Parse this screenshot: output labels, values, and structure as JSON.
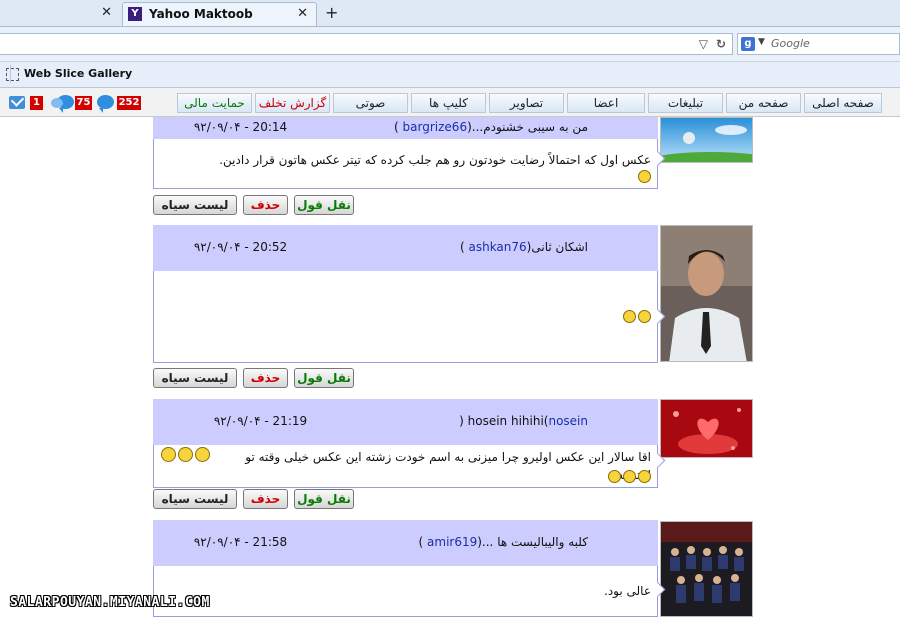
{
  "browser": {
    "tabs": [
      {
        "title": "",
        "close": "✕"
      },
      {
        "title": "Yahoo Maktoob",
        "favicon": "Y",
        "close": "✕"
      }
    ],
    "new_tab": "+",
    "search_placeholder": "Google",
    "search_icon_letter": "g",
    "favorites_item": "Web Slice Gallery"
  },
  "sitenav": {
    "badges": {
      "mail": "1",
      "chat": "75",
      "comments": "252"
    },
    "buttons": [
      "صفحه اصلی",
      "صفحه من",
      "تبلیغات",
      "اعضا",
      "تصاویر",
      "کلیپ ها",
      "صوتی",
      "گزارش تخلف",
      "حمایت مالی"
    ]
  },
  "actions": {
    "blacklist": "لیست سیاه",
    "delete": "حذف",
    "quote": "نقل قول"
  },
  "posts": [
    {
      "time": "۹۲/۰۹/۰۴ - 20:14",
      "title_prefix": "من به سیبی خشنودم...(",
      "username": "bargrize66",
      "title_suffix": " )",
      "text": "عکس اول که احتمالاً رضایت خودتون رو هم جلب کرده که تیتر عکس هاتون قرار دادین.",
      "emoji_count": 1,
      "avatar": "nature-icon"
    },
    {
      "time": "۹۲/۰۹/۰۴ - 20:52",
      "title_prefix": "اشکان ثانی(",
      "username": "ashkan76",
      "title_suffix": " )",
      "text": "",
      "emoji_count": 2,
      "avatar": "person-photo"
    },
    {
      "time": "۹۲/۰۹/۰۴ - 21:19",
      "title_prefix": "hosein hihihi(",
      "username": "nosein",
      "title_suffix": " )",
      "text": "اقا سالار این عکس اولیرو چرا میزنی به اسم خودت زشته این عکس خیلی وقته تو اینترنته",
      "emoji_count": 6,
      "avatar": "red-heart-art"
    },
    {
      "time": "۹۲/۰۹/۰۴ - 21:58",
      "title_prefix": "کلبه والیبالیست ها ...(",
      "username": "amir619",
      "title_suffix": " )",
      "text": "عالی بود.",
      "emoji_count": 0,
      "avatar": "team-photo"
    }
  ],
  "watermark": "SALARPOUYAN.MIYANALI.COM"
}
